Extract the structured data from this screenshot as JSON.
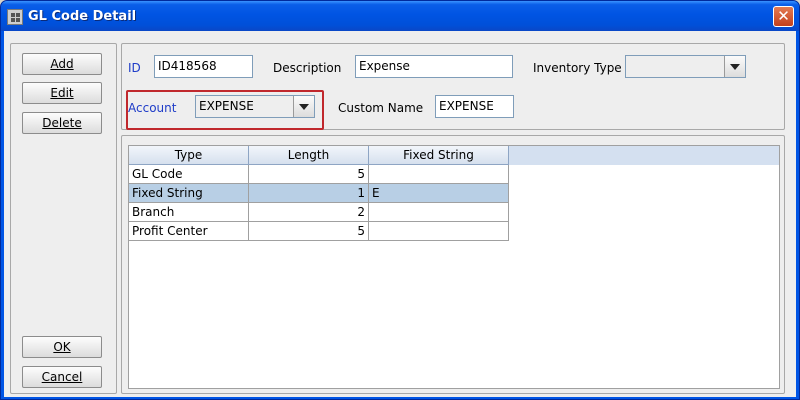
{
  "window": {
    "title": "GL Code Detail",
    "close_glyph": "✕"
  },
  "buttons": {
    "add": "Add",
    "edit": "Edit",
    "delete": "Delete",
    "ok": "OK",
    "cancel": "Cancel"
  },
  "form": {
    "id_label": "ID",
    "id_value": "ID418568",
    "description_label": "Description",
    "description_value": "Expense",
    "inventory_type_label": "Inventory Type",
    "inventory_type_value": "",
    "account_label": "Account",
    "account_value": "EXPENSE",
    "custom_name_label": "Custom Name",
    "custom_name_value": "EXPENSE"
  },
  "table": {
    "columns": [
      "Type",
      "Length",
      "Fixed String"
    ],
    "rows": [
      {
        "type": "GL Code",
        "length": "5",
        "fixed": ""
      },
      {
        "type": "Fixed String",
        "length": "1",
        "fixed": "E"
      },
      {
        "type": "Branch",
        "length": "2",
        "fixed": ""
      },
      {
        "type": "Profit Center",
        "length": "5",
        "fixed": ""
      }
    ],
    "selected_row": 1
  },
  "colors": {
    "highlight_border": "#c0282d",
    "label_blue": "#1e3cc8",
    "selection": "#b8cfe5"
  }
}
